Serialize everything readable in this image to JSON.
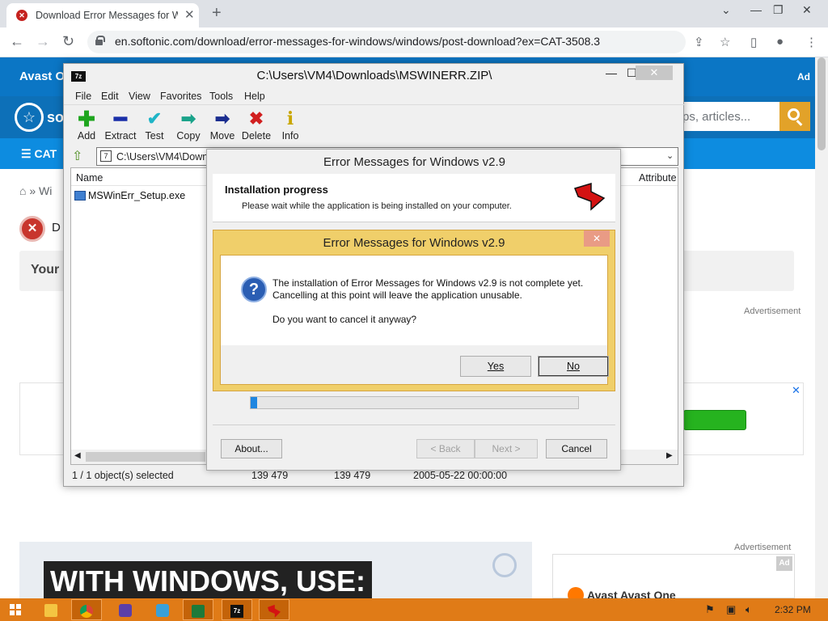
{
  "browser": {
    "tab_title": "Download Error Messages for Windows",
    "url": "en.softonic.com/download/error-messages-for-windows/windows/post-download?ex=CAT-3508.3"
  },
  "site": {
    "topbar_brand": "Avast O",
    "topbar_ad": "Ad",
    "logo_partial": "so",
    "search_placeholder": "ps, articles...",
    "category_label": "CAT",
    "breadcrumb_home": "»",
    "breadcrumb_item": "Wi",
    "download_status_partial": "D",
    "your_box_partial": "Your",
    "advertisement_label": "Advertisement",
    "video_caption": "WITH WINDOWS, USE:",
    "side_ad_label": "Advertisement",
    "side_ad_badge": "Ad",
    "side_ad_text": "Avast   Avast One"
  },
  "zip": {
    "title": "C:\\Users\\VM4\\Downloads\\MSWINERR.ZIP\\",
    "icon_text": "7z",
    "menu": [
      "File",
      "Edit",
      "View",
      "Favorites",
      "Tools",
      "Help"
    ],
    "toolbar": [
      {
        "label": "Add",
        "icon": "add-icon",
        "color": "#1ea51e"
      },
      {
        "label": "Extract",
        "icon": "extract-icon",
        "color": "#1a2fa8"
      },
      {
        "label": "Test",
        "icon": "test-icon",
        "color": "#1fb5c7"
      },
      {
        "label": "Copy",
        "icon": "copy-icon",
        "color": "#1aa38a"
      },
      {
        "label": "Move",
        "icon": "move-icon",
        "color": "#1a2d8f"
      },
      {
        "label": "Delete",
        "icon": "delete-icon",
        "color": "#d11f1f"
      },
      {
        "label": "Info",
        "icon": "info-icon",
        "color": "#c9a600"
      }
    ],
    "path": "C:\\Users\\VM4\\Downlo",
    "columns": {
      "name": "Name",
      "attributes": "Attribute"
    },
    "rows": [
      {
        "name": "MSWinErr_Setup.exe"
      }
    ],
    "status": {
      "selected": "1 / 1 object(s) selected",
      "size": "139 479",
      "packed": "139 479",
      "modified": "2005-05-22 00:00:00"
    }
  },
  "installer": {
    "title": "Error Messages for Windows v2.9",
    "heading": "Installation progress",
    "subheading": "Please wait while the application is being installed on your computer.",
    "progress_fraction": 0.02,
    "buttons": {
      "about": "About...",
      "back": "< Back",
      "next": "Next >",
      "cancel": "Cancel"
    }
  },
  "dialog": {
    "title": "Error Messages for Windows v2.9",
    "line1": "The installation of Error Messages for Windows v2.9 is not complete yet.",
    "line2": "Cancelling at this point will leave the application unusable.",
    "line3": "Do you want to cancel it anyway?",
    "yes": "Yes",
    "no": "No"
  },
  "taskbar": {
    "clock": "2:32 PM",
    "accent": "#e07b17"
  }
}
